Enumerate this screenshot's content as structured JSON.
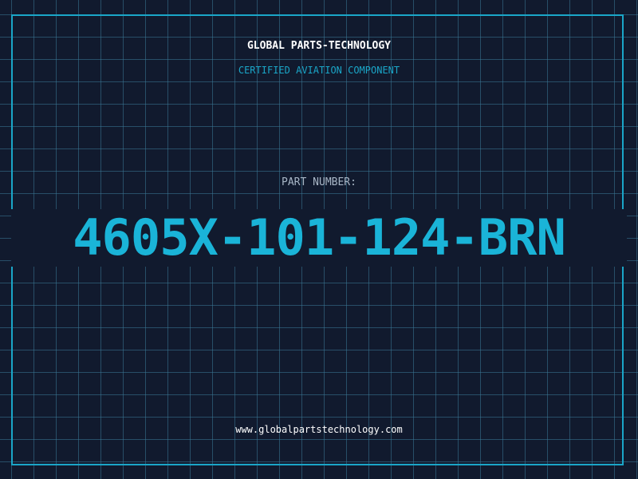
{
  "header": {
    "brand": "GLOBAL PARTS-TECHNOLOGY",
    "tagline": "CERTIFIED AVIATION COMPONENT"
  },
  "part": {
    "label": "PART NUMBER:",
    "number": "4605X-101-124-BRN"
  },
  "footer": {
    "website": "www.globalpartstechnology.com"
  },
  "colors": {
    "background": "#111a2e",
    "accent": "#1ab4d8",
    "grid": "#3a7896"
  }
}
